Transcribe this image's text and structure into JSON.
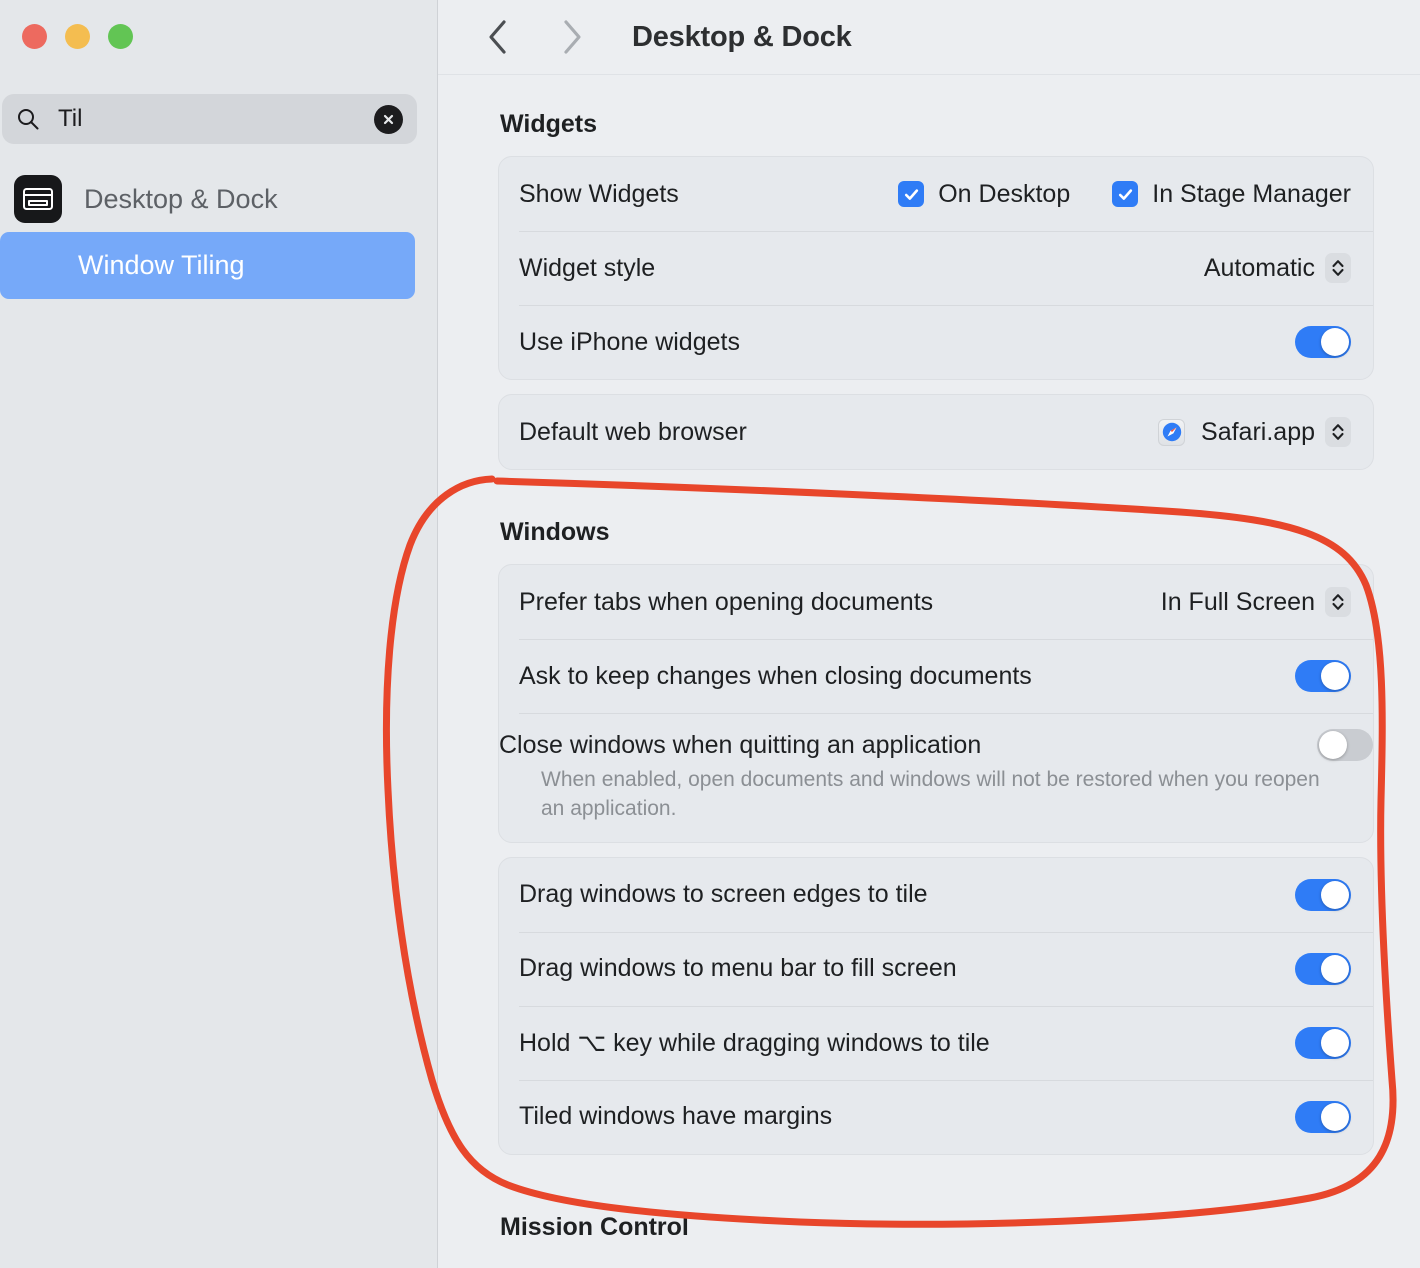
{
  "window": {
    "traffic_lights": [
      "close",
      "minimize",
      "maximize"
    ]
  },
  "sidebar": {
    "search": {
      "value": "Til",
      "placeholder": "Search",
      "icon": "search-icon",
      "clear_icon": "clear-icon"
    },
    "results": [
      {
        "label": "Desktop & Dock",
        "icon": "desktop-and-dock-app-icon",
        "type": "app",
        "selected": false
      },
      {
        "label": "Window Tiling",
        "type": "setting",
        "selected": true
      }
    ]
  },
  "toolbar": {
    "back_icon": "chevron-left-icon",
    "forward_icon": "chevron-right-icon",
    "title": "Desktop & Dock"
  },
  "sections": [
    {
      "title": "Widgets",
      "groups": [
        {
          "rows": [
            {
              "label": "Show Widgets",
              "control": "checkboxes",
              "checkboxes": [
                {
                  "label": "On Desktop",
                  "checked": true
                },
                {
                  "label": "In Stage Manager",
                  "checked": true
                }
              ]
            },
            {
              "label": "Widget style",
              "control": "popup",
              "value": "Automatic"
            },
            {
              "label": "Use iPhone widgets",
              "control": "toggle",
              "on": true
            }
          ]
        },
        {
          "rows": [
            {
              "label": "Default web browser",
              "control": "popup",
              "value": "Safari.app",
              "icon": "safari-icon"
            }
          ]
        }
      ]
    },
    {
      "title": "Windows",
      "groups": [
        {
          "rows": [
            {
              "label": "Prefer tabs when opening documents",
              "control": "popup",
              "value": "In Full Screen"
            },
            {
              "label": "Ask to keep changes when closing documents",
              "control": "toggle",
              "on": true
            },
            {
              "label": "Close windows when quitting an application",
              "description": "When enabled, open documents and windows will not be restored when you reopen an application.",
              "control": "toggle",
              "on": false
            }
          ]
        },
        {
          "rows": [
            {
              "label": "Drag windows to screen edges to tile",
              "control": "toggle",
              "on": true
            },
            {
              "label": "Drag windows to menu bar to fill screen",
              "control": "toggle",
              "on": true
            },
            {
              "label": "Hold ⌥ key while dragging windows to tile",
              "control": "toggle",
              "on": true
            },
            {
              "label": "Tiled windows have margins",
              "control": "toggle",
              "on": true
            }
          ]
        }
      ]
    },
    {
      "title": "Mission Control",
      "groups": []
    }
  ],
  "annotation": {
    "type": "freehand-circle",
    "color": "#e8462b",
    "stroke_width": 7,
    "encloses": "Windows section"
  },
  "colors": {
    "accent": "#2f7cf6",
    "selection": "#76a9f9",
    "sidebar_bg": "#e4e7ea",
    "content_bg": "#eceef1",
    "card_bg": "#e6e9ed",
    "annotation": "#e8462b"
  }
}
